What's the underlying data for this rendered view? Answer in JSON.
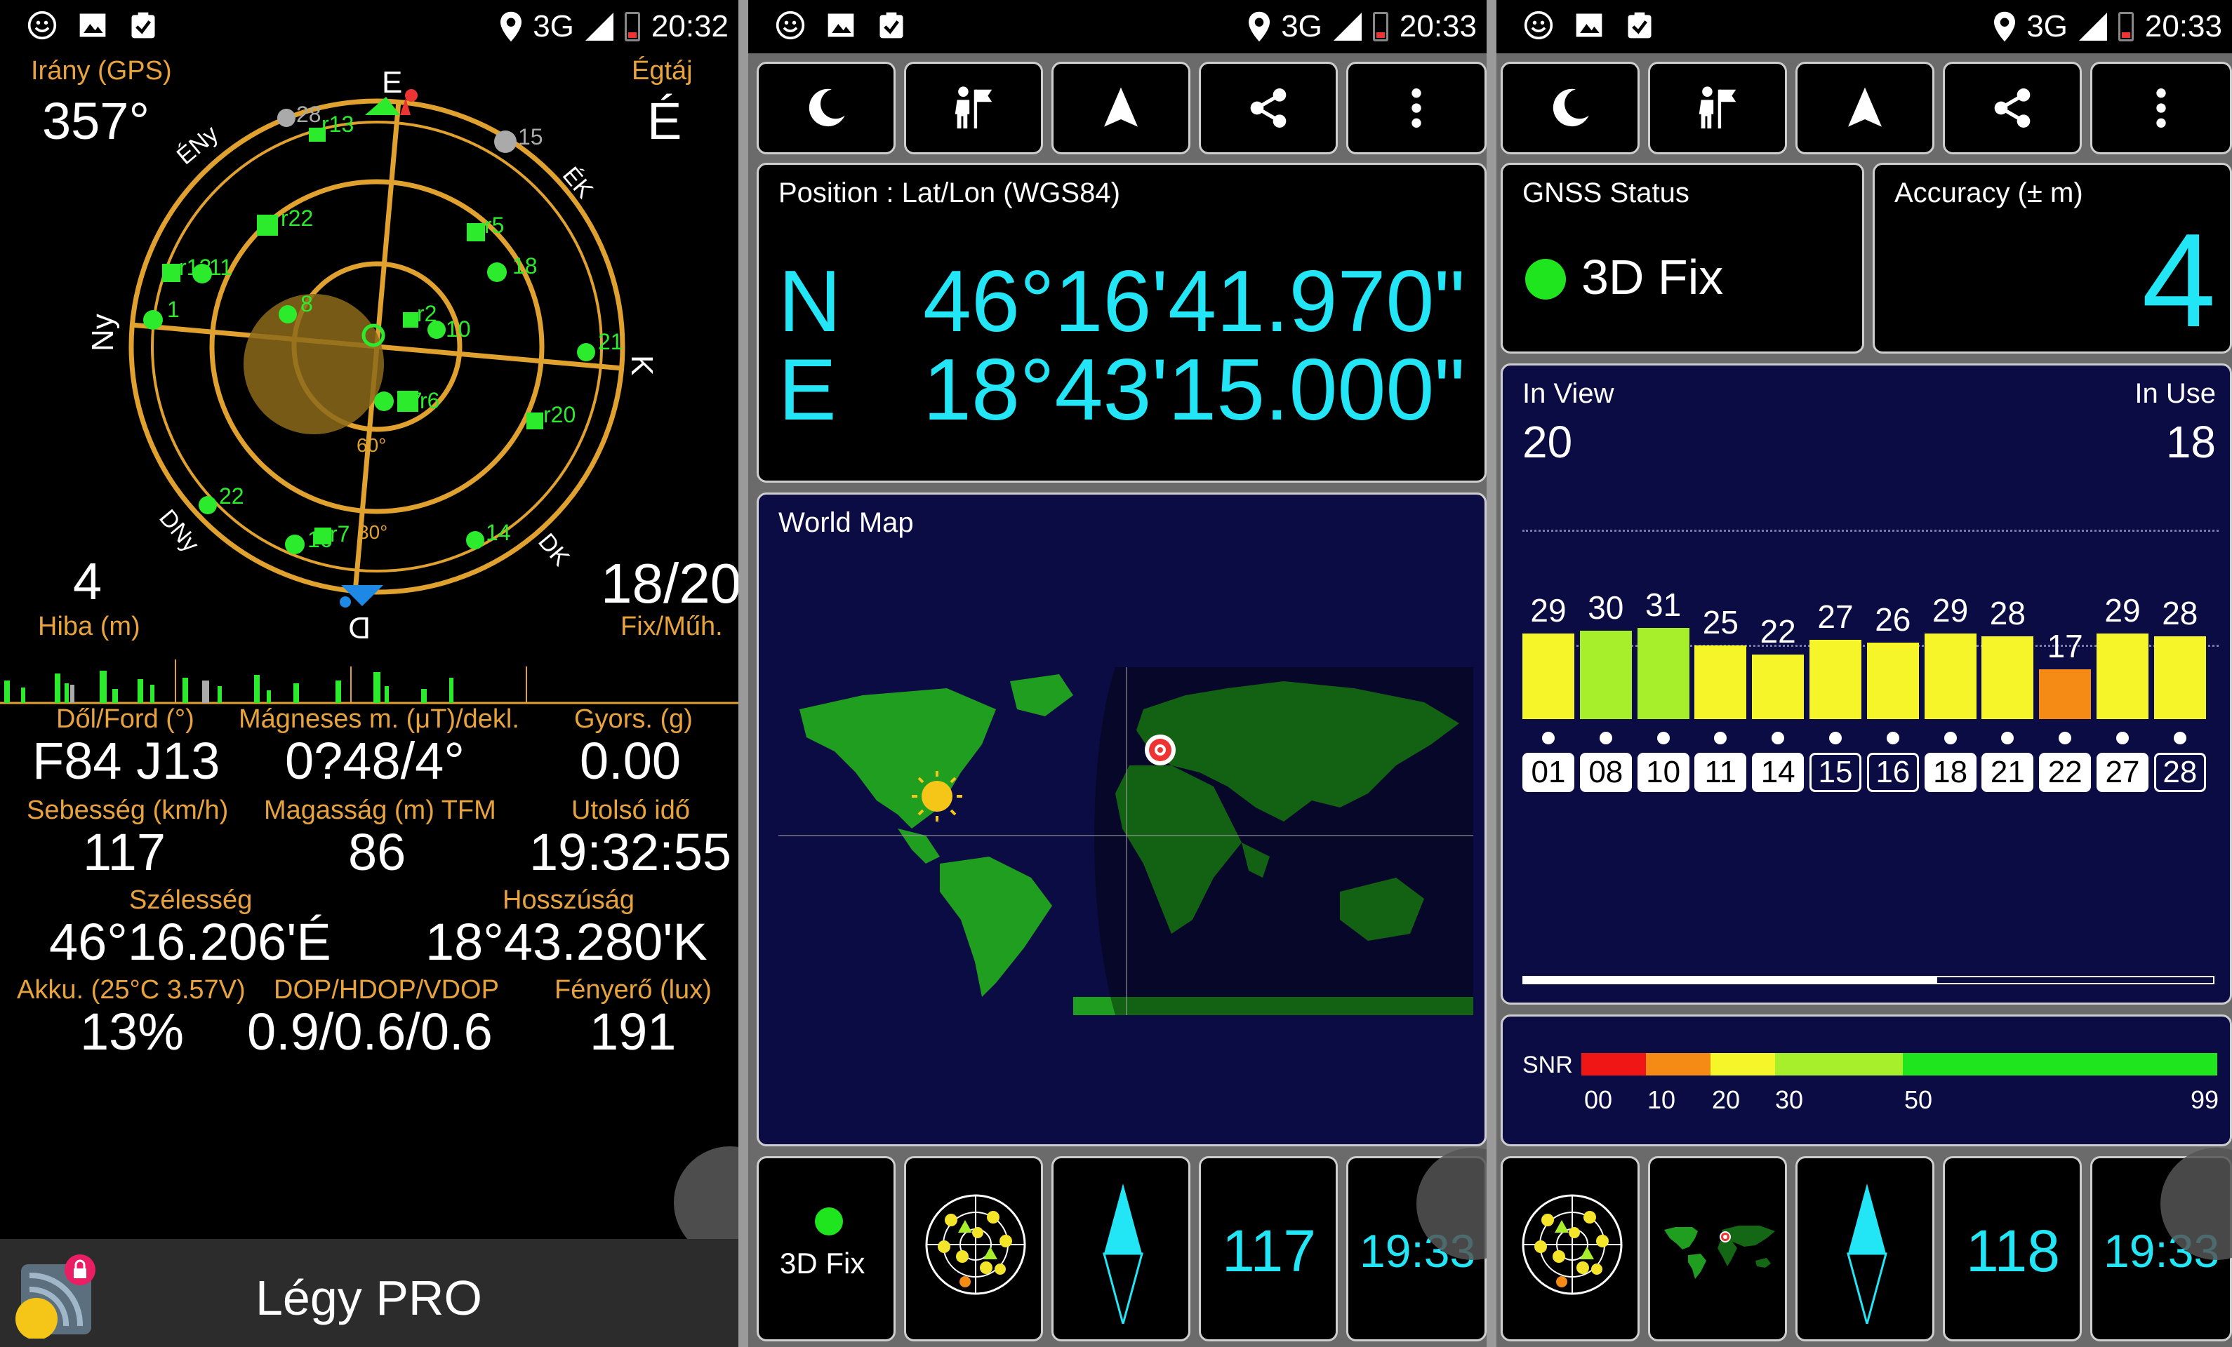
{
  "statusbar": {
    "left_icons": [
      "emoji-icon",
      "image-icon",
      "clipboard-check-icon"
    ],
    "network": "3G",
    "network_sup": "3G",
    "times": [
      "20:32",
      "20:33",
      "20:33"
    ]
  },
  "panel1": {
    "heading_label": "Irány (GPS)",
    "heading_value": "357°",
    "cardinal_label": "Égtáj",
    "cardinal_value": "É",
    "compass": {
      "N": "É",
      "NE": "ÉK",
      "E": "K",
      "SE": "DK",
      "S": "D",
      "SW": "DNy",
      "W": "Ny",
      "NW": "ÉNy",
      "ring_60": "60°",
      "ring_30": "30°"
    },
    "satellites": [
      {
        "id": "28",
        "kind": "grey"
      },
      {
        "id": "15",
        "kind": "grey"
      },
      {
        "id": "r13",
        "kind": "square"
      },
      {
        "id": "r22",
        "kind": "square"
      },
      {
        "id": "r12",
        "kind": "square"
      },
      {
        "id": "11",
        "kind": "dot"
      },
      {
        "id": "1",
        "kind": "dot"
      },
      {
        "id": "8",
        "kind": "dot"
      },
      {
        "id": "r5",
        "kind": "square"
      },
      {
        "id": "18",
        "kind": "dot"
      },
      {
        "id": "r2",
        "kind": "square"
      },
      {
        "id": "10",
        "kind": "dot"
      },
      {
        "id": "21",
        "kind": "dot"
      },
      {
        "id": "27",
        "kind": "dot"
      },
      {
        "id": "r6",
        "kind": "square"
      },
      {
        "id": "r20",
        "kind": "square"
      },
      {
        "id": "22",
        "kind": "dot"
      },
      {
        "id": "16",
        "kind": "dot"
      },
      {
        "id": "r7",
        "kind": "square"
      },
      {
        "id": "14",
        "kind": "dot"
      }
    ],
    "error_value": "4",
    "error_label": "Hiba (m)",
    "fix_value": "18/20",
    "fix_label": "Fix/Műh.",
    "grid": [
      {
        "label": "Dől/Ford (°)",
        "value": "F84 J13"
      },
      {
        "label": "Mágneses m. (μT)/dekl.",
        "value": "0?48/4°"
      },
      {
        "label": "Gyors. (g)",
        "value": "0.00"
      },
      {
        "label": "Sebesség (km/h)",
        "value": "117"
      },
      {
        "label": "Magasság (m) TFM",
        "value": "86"
      },
      {
        "label": "Utolsó idő",
        "value": "19:32:55"
      },
      {
        "label": "Szélesség",
        "value": "46°16.206'É"
      },
      {
        "label": "Hosszúság",
        "value": "18°43.280'K"
      },
      {
        "label": "Akku. (25°C 3.57V)",
        "value": "13%"
      },
      {
        "label": "DOP/HDOP/VDOP",
        "value": "0.9/0.6/0.6"
      },
      {
        "label": "Fényerő (lux)",
        "value": "191"
      }
    ],
    "ad_label": "Légy PRO"
  },
  "panel2": {
    "toolbar": [
      "moon-icon",
      "hiker-flag-icon",
      "navigation-arrow-icon",
      "share-icon",
      "more-vert-icon"
    ],
    "position_title": "Position : Lat/Lon (WGS84)",
    "lat_hemi": "N",
    "lat_value": "46°16'41.970\"",
    "lon_hemi": "E",
    "lon_value": "18°43'15.000\"",
    "map_title": "World Map",
    "bottom": {
      "fix_label": "3D Fix",
      "speed": "117",
      "time": "19:33"
    }
  },
  "panel3": {
    "gnss_title": "GNSS Status",
    "gnss_value": "3D Fix",
    "accuracy_title": "Accuracy (± m)",
    "accuracy_value": "4",
    "in_view_label": "In View",
    "in_view_value": "20",
    "in_use_label": "In Use",
    "in_use_value": "18",
    "snr_bars": [
      {
        "prn": "01",
        "snr": 29,
        "used": true,
        "color": "#f5f52a"
      },
      {
        "prn": "08",
        "snr": 30,
        "used": true,
        "color": "#a6ef2a"
      },
      {
        "prn": "10",
        "snr": 31,
        "used": true,
        "color": "#a6ef2a"
      },
      {
        "prn": "11",
        "snr": 25,
        "used": true,
        "color": "#f5f52a"
      },
      {
        "prn": "14",
        "snr": 22,
        "used": true,
        "color": "#f5f52a"
      },
      {
        "prn": "15",
        "snr": 27,
        "used": false,
        "color": "#f5f52a"
      },
      {
        "prn": "16",
        "snr": 26,
        "used": false,
        "color": "#f5f52a"
      },
      {
        "prn": "18",
        "snr": 29,
        "used": true,
        "color": "#f5f52a"
      },
      {
        "prn": "21",
        "snr": 28,
        "used": true,
        "color": "#f5f52a"
      },
      {
        "prn": "22",
        "snr": 17,
        "used": true,
        "color": "#f58a14"
      },
      {
        "prn": "27",
        "snr": 29,
        "used": true,
        "color": "#f5f52a"
      },
      {
        "prn": "28",
        "snr": 28,
        "used": false,
        "color": "#f5f52a"
      }
    ],
    "snr_label": "SNR",
    "snr_scale": [
      "00",
      "10",
      "20",
      "30",
      "50",
      "99"
    ],
    "bottom": {
      "speed": "118",
      "time": "19:33"
    }
  }
}
